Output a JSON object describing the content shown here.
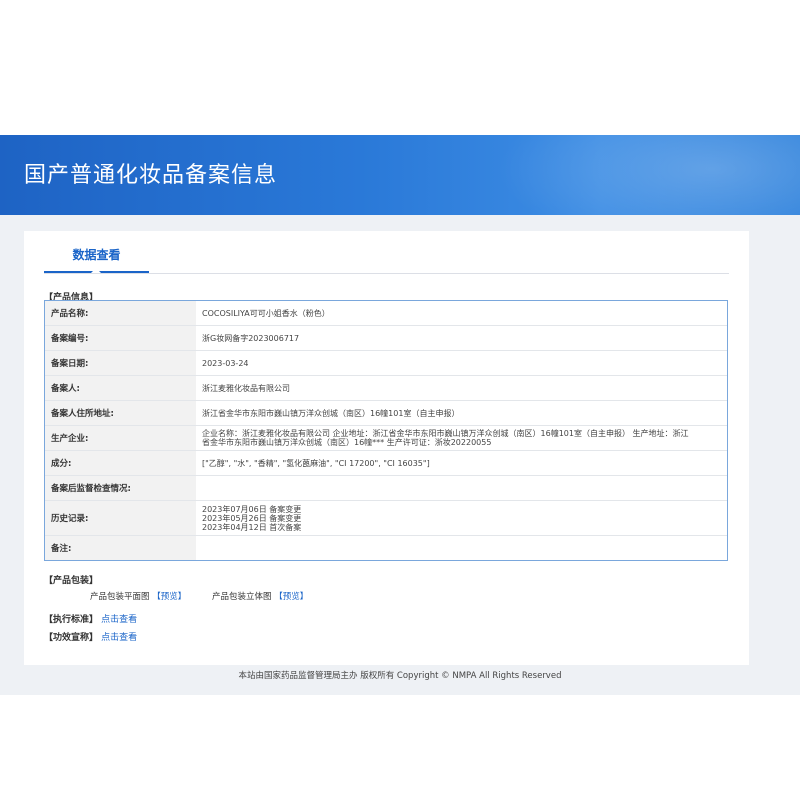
{
  "header": {
    "title": "国产普通化妆品备案信息"
  },
  "tabs": [
    {
      "label": "数据查看"
    }
  ],
  "product_info": {
    "section_label": "【产品信息】",
    "rows": [
      {
        "key": "产品名称:",
        "value": "COCOSILIYA可可小姐香水（粉色）"
      },
      {
        "key": "备案编号:",
        "value": "浙G妆网备字2023006717"
      },
      {
        "key": "备案日期:",
        "value": "2023-03-24"
      },
      {
        "key": "备案人:",
        "value": "浙江麦雅化妆品有限公司"
      },
      {
        "key": "备案人住所地址:",
        "value": "浙江省金华市东阳市巍山镇万洋众创城（南区）16幢101室（自主申报）"
      },
      {
        "key": "生产企业:",
        "value_lines": [
          "企业名称：浙江麦雅化妆品有限公司 企业地址：浙江省金华市东阳市巍山镇万洋众创城（南区）16幢101室（自主申报） 生产地址：浙江",
          "省金华市东阳市巍山镇万洋众创城（南区）16幢*** 生产许可证：浙妆20220055"
        ]
      },
      {
        "key": "成分:",
        "value": "[\"乙醇\", \"水\", \"香精\", \"氢化蓖麻油\", \"CI 17200\", \"CI 16035\"]"
      },
      {
        "key": "备案后监督检查情况:",
        "value": ""
      },
      {
        "key": "历史记录:",
        "value_lines": [
          "2023年07月06日 备案变更",
          "2023年05月26日 备案变更",
          "2023年04月12日 首次备案"
        ]
      },
      {
        "key": "备注:",
        "value": ""
      }
    ]
  },
  "packaging": {
    "section_label": "【产品包装】",
    "flat_label": "产品包装平面图",
    "flat_link": "【预览】",
    "solid_label": "产品包装立体图",
    "solid_link": "【预览】"
  },
  "standard": {
    "label": "【执行标准】",
    "link": "点击查看"
  },
  "efficacy": {
    "label": "【功效宣称】",
    "link": "点击查看"
  },
  "footer": {
    "text": "本站由国家药品监督管理局主办 版权所有 Copyright © NMPA All Rights Reserved"
  }
}
